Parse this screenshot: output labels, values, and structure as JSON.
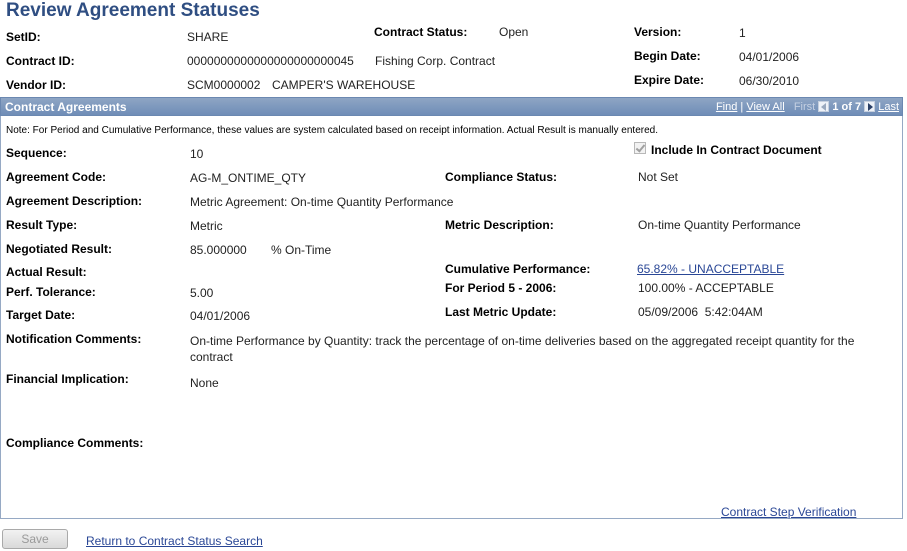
{
  "page_title": "Review Agreement Statuses",
  "header": {
    "setid_label": "SetID:",
    "setid_value": "SHARE",
    "contract_status_label": "Contract Status:",
    "contract_status_value": "Open",
    "version_label": "Version:",
    "version_value": "1",
    "contract_id_label": "Contract ID:",
    "contract_id_value": "0000000000000000000000045",
    "contract_desc": "Fishing Corp. Contract",
    "begin_date_label": "Begin Date:",
    "begin_date_value": "04/01/2006",
    "vendor_id_label": "Vendor ID:",
    "vendor_id_value": "SCM0000002",
    "vendor_name": "CAMPER'S WAREHOUSE",
    "expire_date_label": "Expire Date:",
    "expire_date_value": "06/30/2010"
  },
  "grid": {
    "title": "Contract Agreements",
    "find": "Find",
    "view_all": "View All",
    "first": "First",
    "position": "1 of 7",
    "last": "Last"
  },
  "note": "Note: For Period and Cumulative Performance, these values are system calculated based on receipt information.  Actual Result is manually entered.",
  "agreement": {
    "sequence_label": "Sequence:",
    "sequence_value": "10",
    "include_label": "Include In Contract Document",
    "code_label": "Agreement Code:",
    "code_value": "AG-M_ONTIME_QTY",
    "compliance_status_label": "Compliance Status:",
    "compliance_status_value": "Not Set",
    "desc_label": "Agreement Description:",
    "desc_value": "Metric Agreement: On-time Quantity Performance",
    "result_type_label": "Result Type:",
    "result_type_value": "Metric",
    "metric_desc_label": "Metric Description:",
    "metric_desc_value": "On-time Quantity Performance",
    "negotiated_label": "Negotiated Result:",
    "negotiated_value": "85.000000",
    "negotiated_unit": "% On-Time",
    "actual_label": "Actual Result:",
    "cumulative_label": "Cumulative Performance:",
    "cumulative_value": "65.82% - UNACCEPTABLE",
    "tolerance_label": "Perf. Tolerance:",
    "tolerance_value": "5.00",
    "period_label": "For Period 5 - 2006:",
    "period_value": "100.00% - ACCEPTABLE",
    "target_label": "Target Date:",
    "target_value": "04/01/2006",
    "last_update_label": "Last Metric Update:",
    "last_update_value": "05/09/2006  5:42:04AM",
    "notification_label": "Notification Comments:",
    "notification_value": "On-time Performance by Quantity: track the percentage of on-time deliveries based on the aggregated receipt quantity for the contract",
    "financial_label": "Financial Implication:",
    "financial_value": "None",
    "compliance_comments_label": "Compliance Comments:",
    "step_verification_link": "Contract Step Verification"
  },
  "footer": {
    "save": "Save",
    "return_link": "Return to Contract Status Search"
  },
  "colors": {
    "title": "#2f4e82",
    "link": "#2a4796",
    "grid_header": "#7d97bd"
  }
}
